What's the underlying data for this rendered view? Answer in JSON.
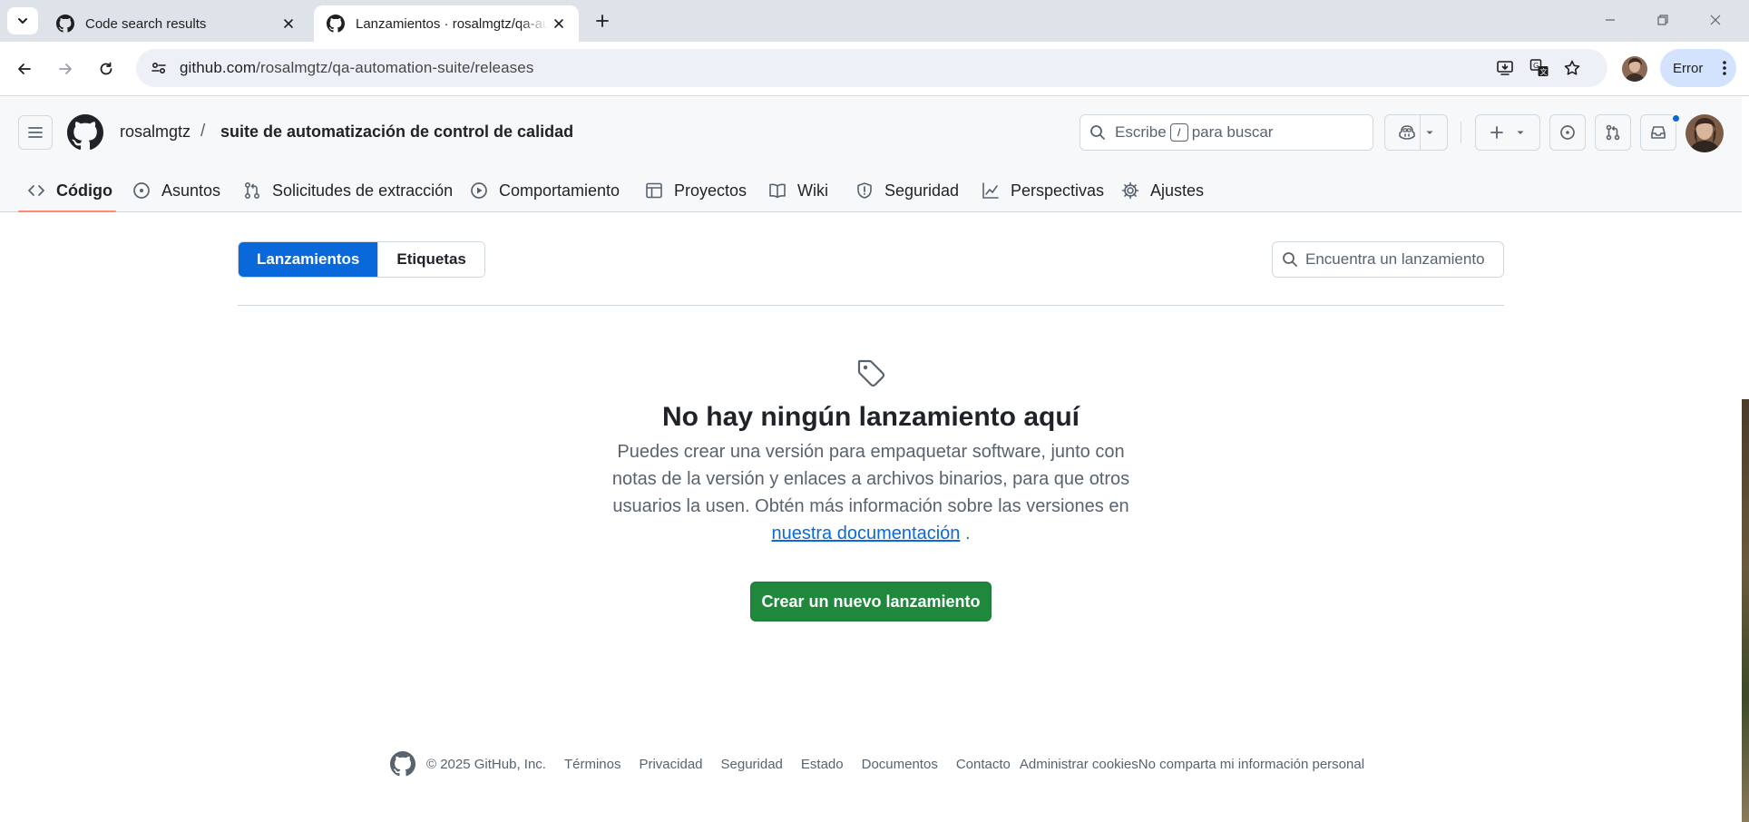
{
  "browser": {
    "tabs": [
      {
        "title": "Code search results",
        "active": false
      },
      {
        "title": "Lanzamientos · rosalmgtz/qa-automation-suite",
        "active": true
      }
    ],
    "url_host": "github.com",
    "url_path": "/rosalmgtz/qa-automation-suite/releases",
    "profile_status": "Error"
  },
  "header": {
    "owner": "rosalmgtz",
    "separator": "/",
    "repo": "suite de automatización de control de calidad",
    "search_prefix": "Escribe",
    "search_key": "/",
    "search_suffix": "para buscar"
  },
  "nav": {
    "items": [
      {
        "label": "Código",
        "icon": "code-icon",
        "selected": true
      },
      {
        "label": "Asuntos",
        "icon": "issue-icon"
      },
      {
        "label": "Solicitudes de extracción",
        "icon": "pull-request-icon"
      },
      {
        "label": "Comportamiento",
        "icon": "play-icon"
      },
      {
        "label": "Proyectos",
        "icon": "table-icon"
      },
      {
        "label": "Wiki",
        "icon": "book-icon"
      },
      {
        "label": "Seguridad",
        "icon": "shield-icon"
      },
      {
        "label": "Perspectivas",
        "icon": "graph-icon"
      },
      {
        "label": "Ajustes",
        "icon": "gear-icon"
      }
    ]
  },
  "releases": {
    "tab_releases": "Lanzamientos",
    "tab_tags": "Etiquetas",
    "search_placeholder": "Encuentra un lanzamiento",
    "empty_title": "No hay ningún lanzamiento aquí",
    "empty_body": "Puedes crear una versión para empaquetar software, junto con notas de la versión y enlaces a archivos binarios, para que otros usuarios la usen. Obtén más información sobre las versiones en",
    "docs_link": "nuestra documentación",
    "docs_suffix": " .",
    "cta": "Crear un nuevo lanzamiento"
  },
  "footer": {
    "copyright": "© 2025 GitHub, Inc.",
    "links": [
      "Términos",
      "Privacidad",
      "Seguridad",
      "Estado",
      "Documentos",
      "Contacto"
    ],
    "cookies": "Administrar cookies",
    "privacy_opt_out": "No comparta mi información personal"
  },
  "colors": {
    "accent": "#0969da",
    "primary_button": "#1f883d",
    "nav_underline": "#fd8c73",
    "notification_dot": "#0969da"
  }
}
